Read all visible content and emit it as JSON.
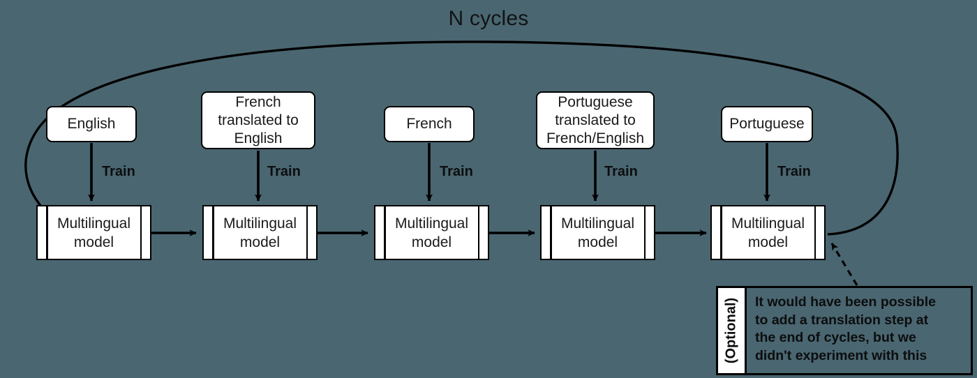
{
  "diagram": {
    "title": "N cycles",
    "background_color": "#4a6670",
    "stroke_color": "#000000",
    "box_fill_color": "#ffffff",
    "train_label": "Train",
    "model_label": "Multilingual\nmodel",
    "columns": [
      {
        "source_label": "English",
        "train_label": "Train",
        "model_label": "Multilingual\nmodel"
      },
      {
        "source_label": "French\ntranslated to\nEnglish",
        "train_label": "Train",
        "model_label": "Multilingual\nmodel"
      },
      {
        "source_label": "French",
        "train_label": "Train",
        "model_label": "Multilingual\nmodel"
      },
      {
        "source_label": "Portuguese\ntranslated to\nFrench/English",
        "train_label": "Train",
        "model_label": "Multilingual\nmodel"
      },
      {
        "source_label": "Portuguese",
        "train_label": "Train",
        "model_label": "Multilingual\nmodel"
      }
    ],
    "note": {
      "tab_label": "(Optional)",
      "body": "It would have been possible\nto add a translation step at\nthe end of cycles, but we\ndidn't experiment with this"
    }
  }
}
